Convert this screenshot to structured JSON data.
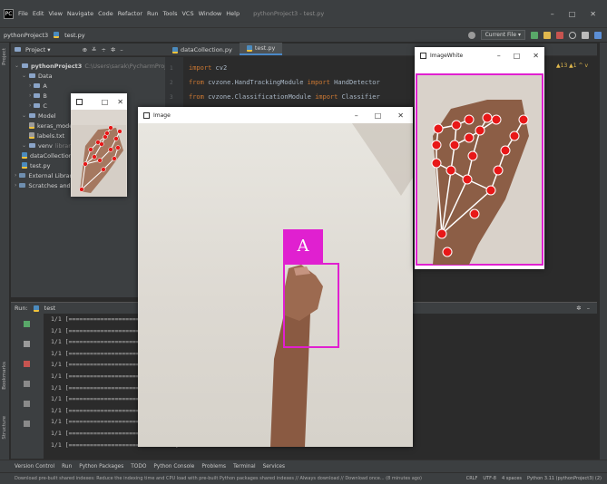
{
  "ide": {
    "app_logo": "PC",
    "menu": [
      "File",
      "Edit",
      "View",
      "Navigate",
      "Code",
      "Refactor",
      "Run",
      "Tools",
      "VCS",
      "Window",
      "Help"
    ],
    "window_title": "pythonProject3 - test.py",
    "window_controls": [
      "–",
      "□",
      "✕"
    ],
    "breadcrumb_project": "pythonProject3",
    "breadcrumb_file": "test.py",
    "run_config": "Current File ▾",
    "project_tool": "Project ▾",
    "left_strip_labels": [
      "Project",
      "Bookmarks",
      "Structure"
    ]
  },
  "project_tree": [
    {
      "label": "pythonProject3",
      "extra": "C:\\Users\\sarak\\PycharmProjects\\p",
      "kind": "folder",
      "depth": 0,
      "bold": true
    },
    {
      "label": "Data",
      "extra": "",
      "kind": "folder",
      "depth": 1
    },
    {
      "label": "A",
      "extra": "",
      "kind": "folder",
      "depth": 2
    },
    {
      "label": "B",
      "extra": "",
      "kind": "folder",
      "depth": 2
    },
    {
      "label": "C",
      "extra": "",
      "kind": "folder",
      "depth": 2
    },
    {
      "label": "Model",
      "extra": "",
      "kind": "folder",
      "depth": 1
    },
    {
      "label": "keras_model.h5",
      "extra": "",
      "kind": "file",
      "depth": 2
    },
    {
      "label": "labels.txt",
      "extra": "",
      "kind": "file",
      "depth": 2
    },
    {
      "label": "venv",
      "extra": "library root",
      "kind": "folder",
      "depth": 1
    },
    {
      "label": "dataCollection.py",
      "extra": "",
      "kind": "py",
      "depth": 1
    },
    {
      "label": "test.py",
      "extra": "",
      "kind": "py",
      "depth": 1
    },
    {
      "label": "External Libraries",
      "extra": "",
      "kind": "lib",
      "depth": 0
    },
    {
      "label": "Scratches and Consoles",
      "extra": "",
      "kind": "lib",
      "depth": 0
    }
  ],
  "editor": {
    "tabs": [
      {
        "label": "dataCollection.py",
        "active": false
      },
      {
        "label": "test.py",
        "active": true
      }
    ],
    "lines": [
      {
        "num": "1",
        "kw": "import",
        "rest": " cv2"
      },
      {
        "num": "2",
        "kw": "from",
        "rest": " cvzone.HandTrackingModule ",
        "kw2": "import",
        "rest2": " HandDetector"
      },
      {
        "num": "3",
        "kw": "from",
        "rest": " cvzone.ClassificationModule ",
        "kw2": "import",
        "rest2": " Classifier"
      }
    ],
    "inspection": "▲13 ▲1 ^ v"
  },
  "run_panel": {
    "title": "Run:",
    "config": "test",
    "console_lines": [
      "1/1 [==============================]",
      "1/1 [==============================]",
      "1/1 [==============================]",
      "1/1 [==============================]",
      "1/1 [==============================]",
      "1/1 [==============================]",
      "1/1 [==============================]",
      "1/1 [==============================]",
      "1/1 [==============================]",
      "1/1 [==============================]",
      "1/1 [==============================]",
      "1/1 [==============================]"
    ]
  },
  "bottom_tabs": [
    "Version Control",
    "Run",
    "Python Packages",
    "TODO",
    "Python Console",
    "Problems",
    "Terminal",
    "Services"
  ],
  "status": {
    "message": "Download pre-built shared indexes: Reduce the indexing time and CPU load with pre-built Python packages shared indexes // Always download // Download once... (8 minutes ago)",
    "line_sep": "CRLF",
    "encoding": "UTF-8",
    "indent": "4 spaces",
    "interpreter": "Python 3.11 (pythonProject3) (2)"
  },
  "windows": {
    "crop": {
      "title": "",
      "controls": [
        "–",
        "□",
        "✕"
      ]
    },
    "image": {
      "title": "Image",
      "controls": [
        "–",
        "□",
        "✕"
      ],
      "label": "A"
    },
    "imagewhite": {
      "title": "ImageWhite",
      "controls": [
        "–",
        "□",
        "✕"
      ]
    }
  },
  "colors": {
    "accent": "#e020d0",
    "landmark": "#e81818",
    "skeleton": "#ffffff",
    "ide_bg": "#2b2b2b",
    "ide_panel": "#3c3f41"
  }
}
